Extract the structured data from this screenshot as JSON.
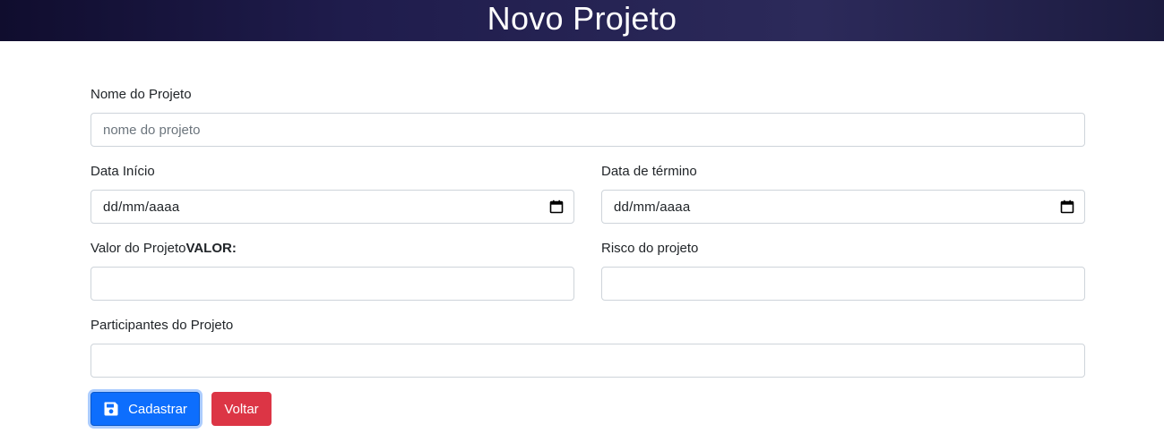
{
  "header": {
    "title": "Novo Projeto"
  },
  "form": {
    "nome": {
      "label": "Nome do Projeto",
      "placeholder": "nome do projeto",
      "value": ""
    },
    "data_inicio": {
      "label": "Data Início",
      "value": "dd/mm/aaaa",
      "icon": "calendar-icon"
    },
    "data_termino": {
      "label": "Data de término",
      "value": "dd/mm/aaaa",
      "icon": "calendar-icon"
    },
    "valor": {
      "label": "Valor do Projeto",
      "label_bold": "VALOR:",
      "value": ""
    },
    "risco": {
      "label": "Risco do projeto",
      "value": ""
    },
    "participantes": {
      "label": "Participantes do Projeto",
      "value": ""
    }
  },
  "buttons": {
    "cadastrar": {
      "label": "Cadastrar",
      "icon": "save-icon",
      "color": "#0d6efd"
    },
    "voltar": {
      "label": "Voltar",
      "color": "#dc3545"
    }
  }
}
